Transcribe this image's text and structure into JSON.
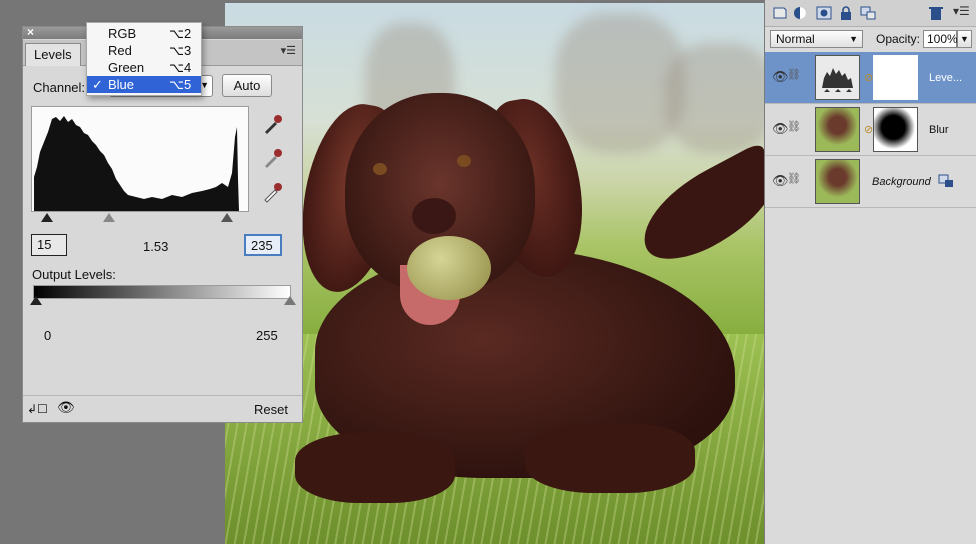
{
  "levels_panel": {
    "tab_label": "Levels",
    "channel_label": "Channel:",
    "auto_label": "Auto",
    "input_black": "15",
    "input_gamma": "1.53",
    "input_white": "235",
    "output_label": "Output Levels:",
    "output_min": "0",
    "output_max": "255",
    "reset_label": "Reset"
  },
  "channel_menu": {
    "items": [
      {
        "label": "RGB",
        "shortcut": "⌥2",
        "checked": false
      },
      {
        "label": "Red",
        "shortcut": "⌥3",
        "checked": false
      },
      {
        "label": "Green",
        "shortcut": "⌥4",
        "checked": false
      },
      {
        "label": "Blue",
        "shortcut": "⌥5",
        "checked": true
      }
    ]
  },
  "layers_panel": {
    "blend_mode": "Normal",
    "opacity_label": "Opacity:",
    "opacity_value": "100%",
    "layers": [
      {
        "name": "Leve...",
        "selected": true
      },
      {
        "name": "Blur",
        "selected": false
      },
      {
        "name": "Background",
        "selected": false
      }
    ]
  },
  "colors": {
    "selection": "#2f63d6",
    "layer_selected": "#6e93c9",
    "panel_bg": "#d8d8d8"
  }
}
